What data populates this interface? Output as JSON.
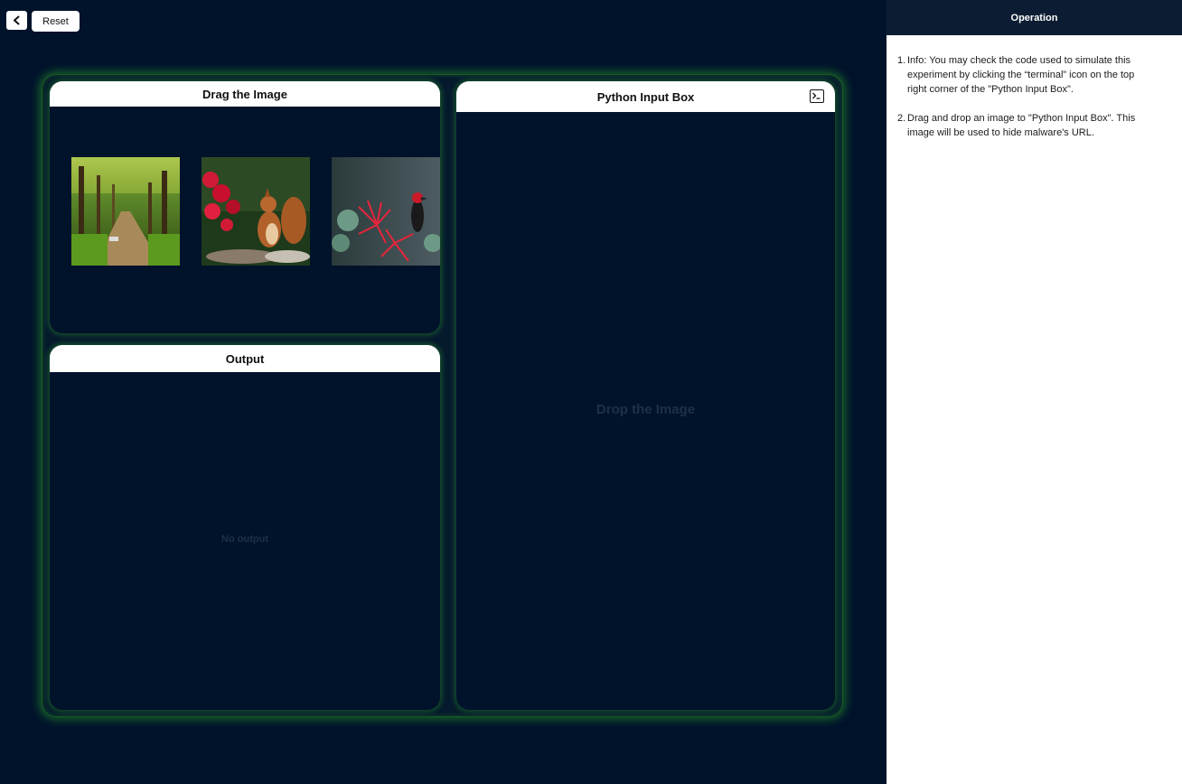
{
  "toolbar": {
    "back_icon": "chevron-left-icon",
    "reset_label": "Reset"
  },
  "drag_panel": {
    "title": "Drag the Image",
    "images": [
      {
        "name": "forest-path-image"
      },
      {
        "name": "squirrel-flowers-image"
      },
      {
        "name": "bird-red-flowers-image"
      }
    ]
  },
  "output_panel": {
    "title": "Output",
    "empty_text": "No output"
  },
  "python_panel": {
    "title": "Python Input Box",
    "drop_text": "Drop the Image",
    "terminal_icon": "terminal-icon"
  },
  "sidebar": {
    "title": "Operation",
    "steps": [
      {
        "number": "1.",
        "text": "Info: You may check the code used to simulate this experiment by clicking the “terminal” icon on the top right corner of the \"Python Input Box\"."
      },
      {
        "number": "2.",
        "text": "Drag and drop an image to \"Python Input Box\". This image will be used to hide malware's URL."
      }
    ]
  },
  "colors": {
    "background": "#01122b",
    "glow": "#1e7828",
    "sidebar_header": "#0c1d33"
  }
}
